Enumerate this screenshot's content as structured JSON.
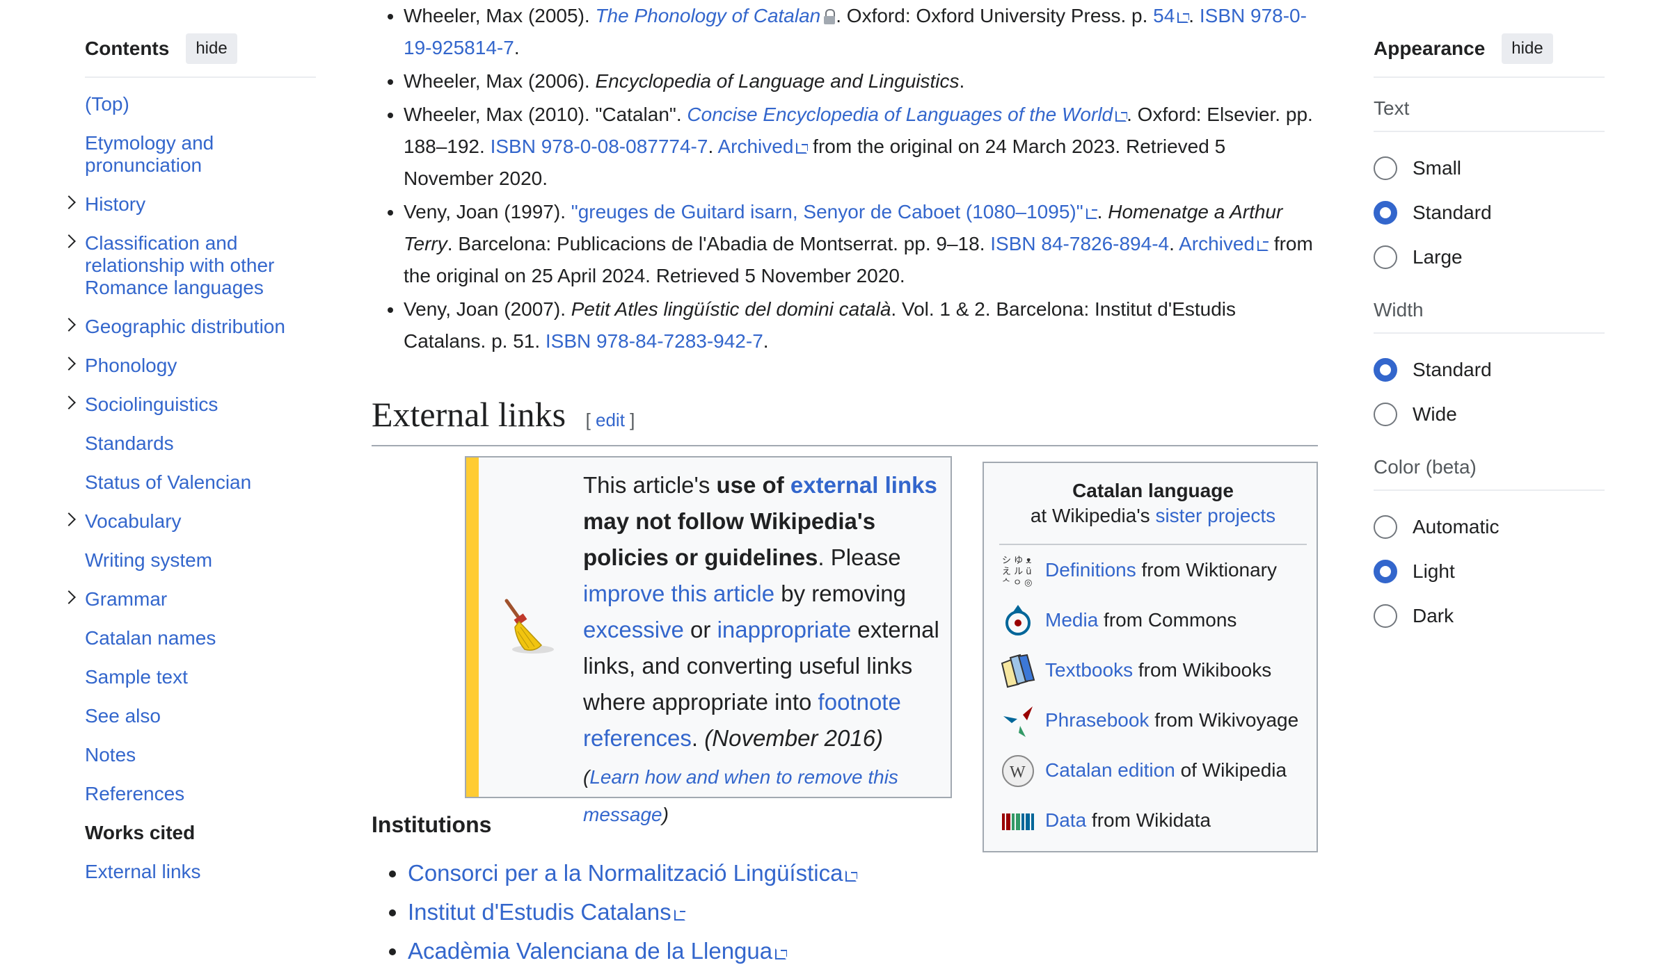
{
  "toc": {
    "title": "Contents",
    "hide": "hide",
    "items": [
      {
        "label": "(Top)",
        "chevron": false
      },
      {
        "label": "Etymology and pronunciation",
        "chevron": false
      },
      {
        "label": "History",
        "chevron": true
      },
      {
        "label": "Classification and relationship with other Romance languages",
        "chevron": true
      },
      {
        "label": "Geographic distribution",
        "chevron": true
      },
      {
        "label": "Phonology",
        "chevron": true
      },
      {
        "label": "Sociolinguistics",
        "chevron": true
      },
      {
        "label": "Standards",
        "chevron": false
      },
      {
        "label": "Status of Valencian",
        "chevron": false
      },
      {
        "label": "Vocabulary",
        "chevron": true
      },
      {
        "label": "Writing system",
        "chevron": false
      },
      {
        "label": "Grammar",
        "chevron": true
      },
      {
        "label": "Catalan names",
        "chevron": false
      },
      {
        "label": "Sample text",
        "chevron": false
      },
      {
        "label": "See also",
        "chevron": false
      },
      {
        "label": "Notes",
        "chevron": false
      },
      {
        "label": "References",
        "chevron": false
      },
      {
        "label": "Works cited",
        "chevron": false,
        "active": true
      },
      {
        "label": "External links",
        "chevron": false
      }
    ]
  },
  "refs": {
    "r1": {
      "a": "Wheeler, Max (2005). ",
      "title": "The Phonology of Catalan",
      "b": ". Oxford: Oxford University Press. p. ",
      "page": "54",
      "c": ". ",
      "isbn": "ISBN 978-0-19-925814-7",
      "d": "."
    },
    "r2": {
      "a": "Wheeler, Max (2006). ",
      "title": "Encyclopedia of Language and Linguistics",
      "b": "."
    },
    "r3": {
      "a": "Wheeler, Max (2010). \"Catalan\". ",
      "title": "Concise Encyclopedia of Languages of the World",
      "b": ". Oxford: Elsevier. pp. 188–192. ",
      "isbn": "ISBN 978-0-08-087774-7",
      "c": ". ",
      "archived": "Archived",
      "d": " from the original on 24 March 2023. Retrieved 5 November 2020."
    },
    "r4": {
      "a": "Veny, Joan (1997). ",
      "link": "\"greuges de Guitard isarn, Senyor de Caboet (1080–1095)\"",
      "b": ". ",
      "title": "Homenatge a Arthur Terry",
      "c": ". Barcelona: Publicacions de l'Abadia de Montserrat. pp. 9–18. ",
      "isbn": "ISBN 84-7826-894-4",
      "d": ". ",
      "archived": "Archived",
      "e": " from the original on 25 April 2024. Retrieved 5 November 2020."
    },
    "r5": {
      "a": "Veny, Joan (2007). ",
      "title": "Petit Atles lingüístic del domini català",
      "b": ". Vol. 1 & 2. Barcelona: Institut d'Estudis Catalans. p. 51. ",
      "isbn": "ISBN 978-84-7283-942-7",
      "c": "."
    }
  },
  "external_links": {
    "heading": "External links",
    "edit": "edit"
  },
  "notice": {
    "t1": "This article's ",
    "b1": "use of ",
    "l1": "external links",
    "b2": " may not follow Wikipedia's policies or guidelines",
    "t2": ". Please ",
    "l2": "improve this article",
    "t3": " by removing ",
    "l3": "excessive",
    "t4": " or ",
    "l4": "inappropriate",
    "t5": " external links, and converting useful links where appropriate into ",
    "l5": "footnote references",
    "t6": ". ",
    "date": "(November 2016)",
    "t7": " (",
    "l6": "Learn how and when to remove this message",
    "t8": ")"
  },
  "sister": {
    "title": "Catalan language",
    "sub1": "at Wikipedia's ",
    "sub_link": "sister projects",
    "items": [
      {
        "link": "Definitions",
        "text": " from Wiktionary",
        "icon": "wiktionary-icon"
      },
      {
        "link": "Media",
        "text": " from Commons",
        "icon": "commons-icon"
      },
      {
        "link": "Textbooks",
        "text": " from Wikibooks",
        "icon": "wikibooks-icon"
      },
      {
        "link": "Phrasebook",
        "text": " from Wikivoyage",
        "icon": "wikivoyage-icon"
      },
      {
        "link": "Catalan edition",
        "text": " of Wikipedia",
        "icon": "wikipedia-icon"
      },
      {
        "link": "Data",
        "text": " from Wikidata",
        "icon": "wikidata-icon"
      }
    ]
  },
  "institutions": {
    "title": "Institutions",
    "items": [
      "Consorci per a la Normalització Lingüística",
      "Institut d'Estudis Catalans",
      "Acadèmia Valenciana de la Llengua"
    ]
  },
  "appearance": {
    "title": "Appearance",
    "hide": "hide",
    "text_title": "Text",
    "text_options": [
      {
        "label": "Small",
        "on": false
      },
      {
        "label": "Standard",
        "on": true
      },
      {
        "label": "Large",
        "on": false
      }
    ],
    "width_title": "Width",
    "width_options": [
      {
        "label": "Standard",
        "on": true
      },
      {
        "label": "Wide",
        "on": false
      }
    ],
    "color_title": "Color (beta)",
    "color_options": [
      {
        "label": "Automatic",
        "on": false
      },
      {
        "label": "Light",
        "on": true
      },
      {
        "label": "Dark",
        "on": false
      }
    ]
  },
  "colors": {
    "link": "#3366cc",
    "notice_bar": "#ffcc33",
    "text": "#202122"
  }
}
